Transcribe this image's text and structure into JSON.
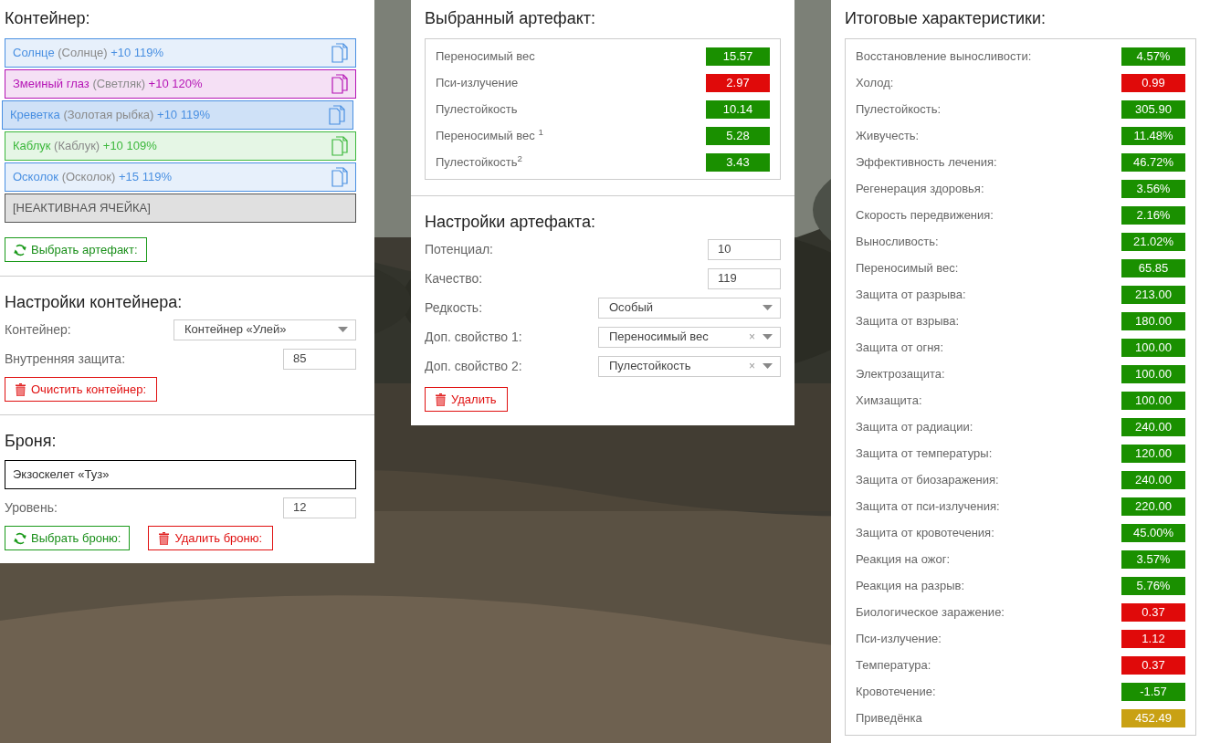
{
  "container": {
    "title": "Контейнер:",
    "slots": [
      {
        "kind": "artifact",
        "name": "Солнце",
        "base": "(Солнце)",
        "bonus": "+10 119%",
        "color": "#4a90e2",
        "selected": false
      },
      {
        "kind": "artifact",
        "name": "Змеиный глаз",
        "base": "(Светляк)",
        "bonus": "+10 120%",
        "color": "#b515b5",
        "selected": false
      },
      {
        "kind": "artifact",
        "name": "Креветка",
        "base": "(Золотая рыбка)",
        "bonus": "+10 119%",
        "color": "#4a90e2",
        "selected": true
      },
      {
        "kind": "artifact",
        "name": "Каблук",
        "base": "(Каблук)",
        "bonus": "+10 109%",
        "color": "#3cb83c",
        "selected": false
      },
      {
        "kind": "artifact",
        "name": "Осколок",
        "base": "(Осколок)",
        "bonus": "+15 119%",
        "color": "#4a90e2",
        "selected": false
      },
      {
        "kind": "inactive",
        "name": "[НЕАКТИВНАЯ ЯЧЕЙКА]"
      }
    ],
    "button": "Выбрать артефакт:"
  },
  "container_settings": {
    "title": "Настройки контейнера:",
    "fields": [
      {
        "kind": "select",
        "label": "Контейнер:",
        "value": "Контейнер «Улей»"
      },
      {
        "kind": "number",
        "label": "Внутренняя защита:",
        "value": "85"
      }
    ],
    "button": "Очистить контейнер:"
  },
  "armor": {
    "title": "Броня:",
    "value": "Экзоскелет «Туз»",
    "fields": [
      {
        "kind": "number",
        "label": "Уровень:",
        "value": "12"
      }
    ],
    "buttons": [
      {
        "kind": "select",
        "label": "Выбрать броню:"
      },
      {
        "kind": "delete",
        "label": "Удалить броню:"
      }
    ]
  },
  "selected_artifact": {
    "title": "Выбранный артефакт:",
    "stats": [
      {
        "label": "Переносимый вес",
        "value": "15.57",
        "color": "#1a9000"
      },
      {
        "label": "Пси-излучение",
        "value": "2.97",
        "color": "#e00a0a"
      },
      {
        "label": "Пулестойкость",
        "value": "10.14",
        "color": "#1a9000"
      },
      {
        "label": "Переносимый вес $^{1}$",
        "value": "5.28",
        "color": "#1a9000"
      },
      {
        "label": "Пулестойкость$^{2}$",
        "value": "3.43",
        "color": "#1a9000"
      }
    ]
  },
  "artifact_settings": {
    "title": "Настройки артефакта:",
    "fields": [
      {
        "kind": "number",
        "label": "Потенциал:",
        "value": "10"
      },
      {
        "kind": "number",
        "label": "Качество:",
        "value": "119"
      },
      {
        "kind": "select",
        "label": "Редкость:",
        "value": "Особый"
      },
      {
        "kind": "select",
        "label": "Доп. свойство 1:",
        "value": "Переносимый вес",
        "clear": "×"
      },
      {
        "kind": "select",
        "label": "Доп. свойство 2:",
        "value": "Пулестойкость",
        "clear": "×"
      }
    ],
    "button": "Удалить"
  },
  "totals": {
    "title": "Итоговые характеристики:",
    "stats": [
      {
        "label": "Восстановление выносливости:",
        "value": "4.57%",
        "color": "#1a9000"
      },
      {
        "label": "Холод:",
        "value": "0.99",
        "color": "#e00a0a"
      },
      {
        "label": "Пулестойкость:",
        "value": "305.90",
        "color": "#1a9000"
      },
      {
        "label": "Живучесть:",
        "value": "11.48%",
        "color": "#1a9000"
      },
      {
        "label": "Эффективность лечения:",
        "value": "46.72%",
        "color": "#1a9000"
      },
      {
        "label": "Регенерация здоровья:",
        "value": "3.56%",
        "color": "#1a9000"
      },
      {
        "label": "Скорость передвижения:",
        "value": "2.16%",
        "color": "#1a9000"
      },
      {
        "label": "Выносливость:",
        "value": "21.02%",
        "color": "#1a9000"
      },
      {
        "label": "Переносимый вес:",
        "value": "65.85",
        "color": "#1a9000"
      },
      {
        "label": "Защита от разрыва:",
        "value": "213.00",
        "color": "#1a9000"
      },
      {
        "label": "Защита от взрыва:",
        "value": "180.00",
        "color": "#1a9000"
      },
      {
        "label": "Защита от огня:",
        "value": "100.00",
        "color": "#1a9000"
      },
      {
        "label": "Электрозащита:",
        "value": "100.00",
        "color": "#1a9000"
      },
      {
        "label": "Химзащита:",
        "value": "100.00",
        "color": "#1a9000"
      },
      {
        "label": "Защита от радиации:",
        "value": "240.00",
        "color": "#1a9000"
      },
      {
        "label": "Защита от температуры:",
        "value": "120.00",
        "color": "#1a9000"
      },
      {
        "label": "Защита от биозаражения:",
        "value": "240.00",
        "color": "#1a9000"
      },
      {
        "label": "Защита от пси-излучения:",
        "value": "220.00",
        "color": "#1a9000"
      },
      {
        "label": "Защита от кровотечения:",
        "value": "45.00%",
        "color": "#1a9000"
      },
      {
        "label": "Реакция на ожог:",
        "value": "3.57%",
        "color": "#1a9000"
      },
      {
        "label": "Реакция на разрыв:",
        "value": "5.76%",
        "color": "#1a9000"
      },
      {
        "label": "Биологическое заражение:",
        "value": "0.37",
        "color": "#e00a0a"
      },
      {
        "label": "Пси-излучение:",
        "value": "1.12",
        "color": "#e00a0a"
      },
      {
        "label": "Температура:",
        "value": "0.37",
        "color": "#e00a0a"
      },
      {
        "label": "Кровотечение:",
        "value": "-1.57",
        "color": "#1a9000"
      },
      {
        "label": "Приведёнка",
        "value": "452.49",
        "color": "#c9a114"
      }
    ]
  }
}
